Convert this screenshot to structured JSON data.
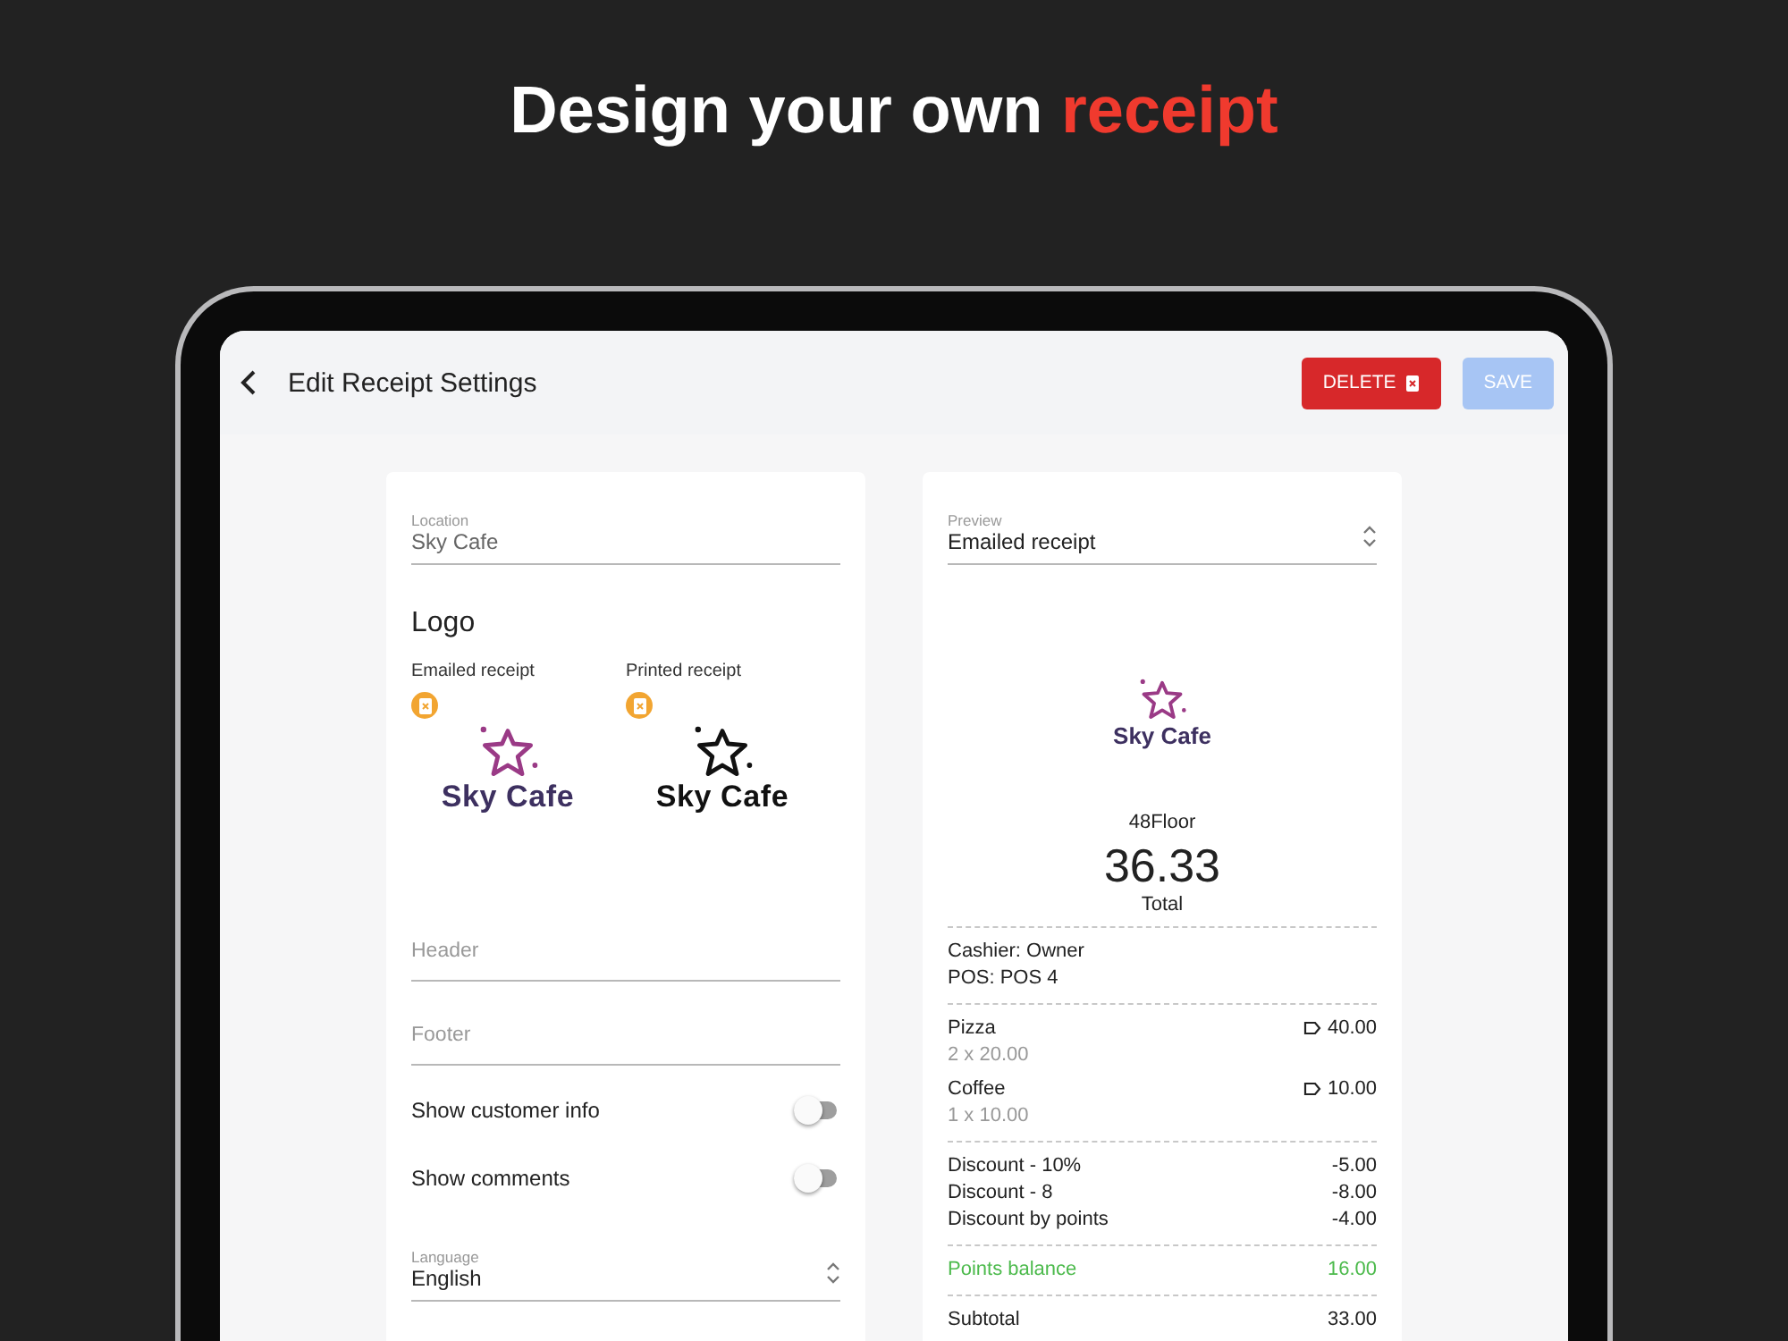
{
  "headline": {
    "text": "Design your own",
    "accent": "receipt"
  },
  "header": {
    "title": "Edit Receipt Settings",
    "delete_label": "DELETE",
    "save_label": "SAVE",
    "save_disabled": true
  },
  "settings": {
    "location": {
      "label": "Location",
      "value": "Sky Cafe"
    },
    "logo_title": "Logo",
    "logos": [
      {
        "label": "Emailed receipt",
        "kind": "color",
        "brand": "Sky Cafe"
      },
      {
        "label": "Printed receipt",
        "kind": "mono",
        "brand": "Sky Cafe"
      }
    ],
    "header_field": {
      "placeholder": "Header"
    },
    "footer_field": {
      "placeholder": "Footer"
    },
    "toggles": [
      {
        "label": "Show customer info",
        "on": false
      },
      {
        "label": "Show comments",
        "on": false
      }
    ],
    "language": {
      "label": "Language",
      "value": "English"
    }
  },
  "preview": {
    "select": {
      "label": "Preview",
      "value": "Emailed receipt"
    },
    "brand": "Sky Cafe",
    "store": "48Floor",
    "total": "36.33",
    "total_label": "Total",
    "info": [
      "Cashier: Owner",
      "POS: POS 4"
    ],
    "items": [
      {
        "name": "Pizza",
        "qty": "2 x 20.00",
        "price": "40.00"
      },
      {
        "name": "Coffee",
        "qty": "1 x 10.00",
        "price": "10.00"
      }
    ],
    "discounts": [
      {
        "label": "Discount - 10%",
        "amount": "-5.00"
      },
      {
        "label": "Discount - 8",
        "amount": "-8.00"
      },
      {
        "label": "Discount by points",
        "amount": "-4.00"
      }
    ],
    "points": {
      "label": "Points balance",
      "value": "16.00"
    },
    "subtotal": {
      "label": "Subtotal",
      "value": "33.00"
    }
  }
}
